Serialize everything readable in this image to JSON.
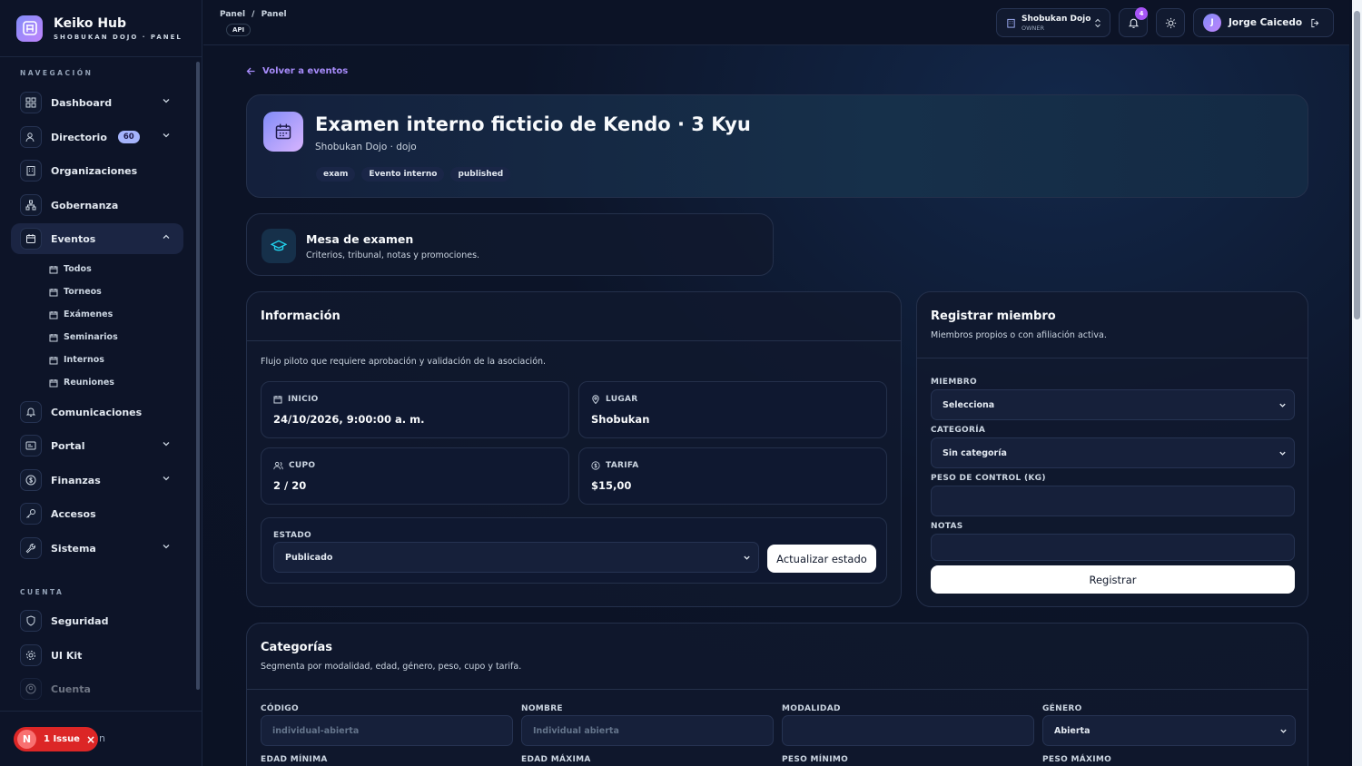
{
  "brand": {
    "title": "Keiko Hub",
    "subtitle": "SHOBUKAN DOJO · PANEL"
  },
  "nav": {
    "section_nav": "NAVEGACIÓN",
    "items": [
      {
        "label": "Dashboard",
        "icon": "grid-icon"
      },
      {
        "label": "Directorio",
        "badge": "60",
        "icon": "users-icon"
      },
      {
        "label": "Organizaciones",
        "icon": "building-icon"
      },
      {
        "label": "Gobernanza",
        "icon": "network-icon"
      },
      {
        "label": "Eventos",
        "icon": "calendar-icon"
      },
      {
        "label": "Comunicaciones",
        "icon": "bell-icon"
      },
      {
        "label": "Portal",
        "icon": "portal-icon"
      },
      {
        "label": "Finanzas",
        "icon": "dollar-icon"
      },
      {
        "label": "Accesos",
        "icon": "key-icon"
      },
      {
        "label": "Sistema",
        "icon": "wrench-icon"
      }
    ],
    "sub_items": [
      "Todos",
      "Torneos",
      "Exámenes",
      "Seminarios",
      "Internos",
      "Reuniones"
    ],
    "section_account": "CUENTA",
    "account_items": [
      "Seguridad",
      "UI Kit",
      "Cuenta"
    ]
  },
  "issue": {
    "letter": "N",
    "label": "1 Issue",
    "close": "×",
    "trail": "n"
  },
  "topbar": {
    "breadcrumb_1": "Panel",
    "breadcrumb_sep": "/",
    "breadcrumb_2": "Panel",
    "api_badge": "API",
    "org_name": "Shobukan Dojo",
    "org_role": "OWNER",
    "notif_count": "4",
    "user_initial": "J",
    "user_name": "Jorge Caicedo"
  },
  "back_link": "Volver a eventos",
  "event": {
    "title": "Examen interno ficticio de Kendo · 3 Kyu",
    "subtitle": "Shobukan Dojo · dojo",
    "tags": [
      "exam",
      "Evento interno",
      "published"
    ]
  },
  "mesa": {
    "title": "Mesa de examen",
    "desc": "Criterios, tribunal, notas y promociones."
  },
  "info": {
    "title": "Información",
    "desc": "Flujo piloto que requiere aprobación y validación de la asociación.",
    "inicio_label": "INICIO",
    "inicio_value": "24/10/2026, 9:00:00 a. m.",
    "lugar_label": "LUGAR",
    "lugar_value": "Shobukan",
    "cupo_label": "CUPO",
    "cupo_value": "2 / 20",
    "tarifa_label": "TARIFA",
    "tarifa_value": "$15,00",
    "estado_label": "ESTADO",
    "estado_value": "Publicado",
    "update_button": "Actualizar estado"
  },
  "register": {
    "title": "Registrar miembro",
    "desc": "Miembros propios o con afiliación activa.",
    "miembro_label": "MIEMBRO",
    "miembro_value": "Selecciona",
    "categoria_label": "CATEGORÍA",
    "categoria_value": "Sin categoría",
    "peso_label": "PESO DE CONTROL (KG)",
    "notas_label": "NOTAS",
    "submit": "Registrar"
  },
  "categorias": {
    "title": "Categorías",
    "desc": "Segmenta por modalidad, edad, género, peso, cupo y tarifa.",
    "codigo_label": "CÓDIGO",
    "codigo_placeholder": "individual-abierta",
    "nombre_label": "NOMBRE",
    "nombre_placeholder": "Individual abierta",
    "modalidad_label": "MODALIDAD",
    "genero_label": "GÉNERO",
    "genero_value": "Abierta",
    "edad_min_label": "EDAD MÍNIMA",
    "edad_max_label": "EDAD MÁXIMA",
    "peso_min_label": "PESO MÍNIMO",
    "peso_max_label": "PESO MÁXIMO"
  }
}
